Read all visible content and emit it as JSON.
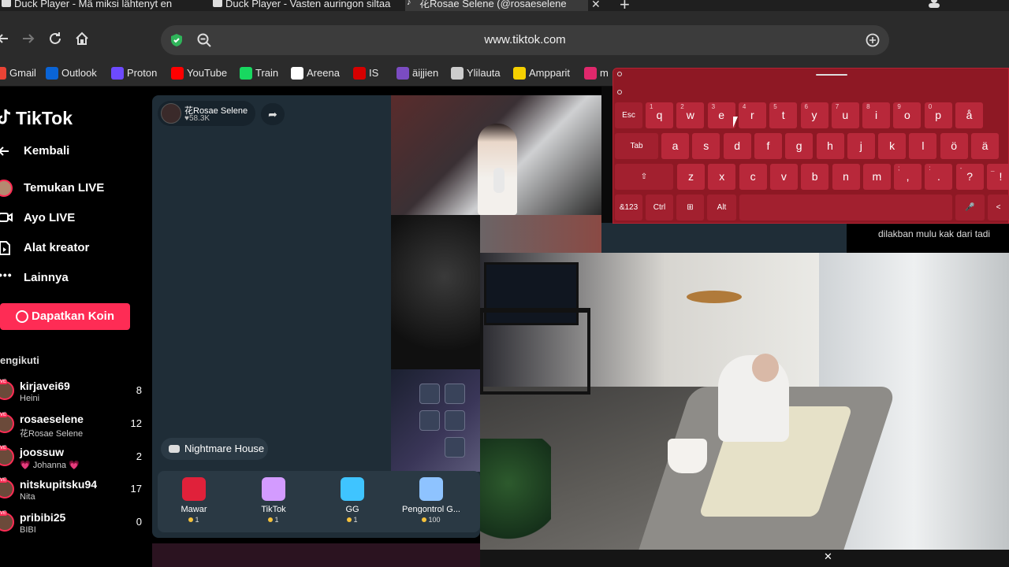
{
  "browser": {
    "tabs": [
      {
        "title": "Duck Player - Mä miksi lähtenyt en",
        "active": false
      },
      {
        "title": "Duck Player - Vasten auringon siltaa",
        "active": false
      },
      {
        "title": "花Rosae Selene (@rosaeselene",
        "active": true
      }
    ],
    "tab_close": "✕",
    "new_tab": "+",
    "url": "www.tiktok.com",
    "bookmarks": [
      {
        "label": "Gmail",
        "color": "#ea4335"
      },
      {
        "label": "Outlook",
        "color": "#0a64d6"
      },
      {
        "label": "Proton",
        "color": "#6d4aff"
      },
      {
        "label": "YouTube",
        "color": "#ff0000"
      },
      {
        "label": "Train",
        "color": "#18d860"
      },
      {
        "label": "Areena",
        "color": "#ffffff"
      },
      {
        "label": "IS",
        "color": "#d60000"
      },
      {
        "label": "äijjien",
        "color": "#7b4cc2"
      },
      {
        "label": "Ylilauta",
        "color": "#cccccc"
      },
      {
        "label": "Ampparit",
        "color": "#f5d000"
      },
      {
        "label": "m",
        "color": "#e0286c"
      }
    ]
  },
  "sidebar": {
    "logo": "TikTok",
    "nav": [
      {
        "label": "Kembali",
        "icon": "arrow-left-icon"
      },
      {
        "label": "Temukan LIVE",
        "icon": "live-avatar-icon"
      },
      {
        "label": "Ayo LIVE",
        "icon": "video-camera-icon"
      },
      {
        "label": "Alat kreator",
        "icon": "creator-tools-icon"
      },
      {
        "label": "Lainnya",
        "icon": "more-dots-icon"
      }
    ],
    "coins_button": "Dapatkan Koin",
    "following_label": "engikuti",
    "following": [
      {
        "name": "kirjavei69",
        "sub": "Heini",
        "count": "8"
      },
      {
        "name": "rosaeselene",
        "sub": "花Rosae Selene",
        "count": "12"
      },
      {
        "name": "joossuw",
        "sub": "💗 Johanna 💗",
        "count": "2"
      },
      {
        "name": "nitskupitsku94",
        "sub": "Nita",
        "count": "17"
      },
      {
        "name": "pribibi25",
        "sub": "BIBI",
        "count": "0"
      }
    ],
    "live_badge": "LIVE"
  },
  "stream": {
    "host_name": "花Rosae Selene",
    "host_viewers": "♥58.3K",
    "share_icon": "➦",
    "game_tag": "Nightmare House",
    "gifts": [
      {
        "label": "Mawar",
        "price": "1",
        "color": "#e0213a"
      },
      {
        "label": "TikTok",
        "price": "1",
        "color": "#d39bff"
      },
      {
        "label": "GG",
        "price": "1",
        "color": "#3fc4ff"
      },
      {
        "label": "Pengontrol G...",
        "price": "100",
        "color": "#8ec3ff"
      }
    ]
  },
  "chat": {
    "line": "dilakban mulu kak dari tadi"
  },
  "keyboard": {
    "row1": [
      {
        "k": "Esc",
        "n": ""
      },
      {
        "k": "q",
        "n": "1"
      },
      {
        "k": "w",
        "n": "2"
      },
      {
        "k": "e",
        "n": "3"
      },
      {
        "k": "r",
        "n": "4"
      },
      {
        "k": "t",
        "n": "5"
      },
      {
        "k": "y",
        "n": "6"
      },
      {
        "k": "u",
        "n": "7"
      },
      {
        "k": "i",
        "n": "8"
      },
      {
        "k": "o",
        "n": "9"
      },
      {
        "k": "p",
        "n": "0"
      },
      {
        "k": "å",
        "n": ""
      }
    ],
    "row2": [
      "Tab",
      "a",
      "s",
      "d",
      "f",
      "g",
      "h",
      "j",
      "k",
      "l",
      "ö",
      "ä"
    ],
    "row3": [
      "⇧",
      "z",
      "x",
      "c",
      "v",
      "b",
      "n",
      "m",
      ",",
      ".",
      "?",
      "!"
    ],
    "row3_sub": [
      "",
      "",
      "",
      "",
      "",
      "",
      "",
      "",
      ";",
      ":",
      "-",
      "_"
    ],
    "row4": [
      "&123",
      "Ctrl",
      "⊞",
      "Alt",
      "",
      "🎤",
      "<"
    ]
  },
  "pip": {
    "close": "✕"
  },
  "colors": {
    "tiktok_red": "#fe2c55",
    "keyboard_bg": "#8e1824",
    "stream_bg": "#1f2d37"
  }
}
